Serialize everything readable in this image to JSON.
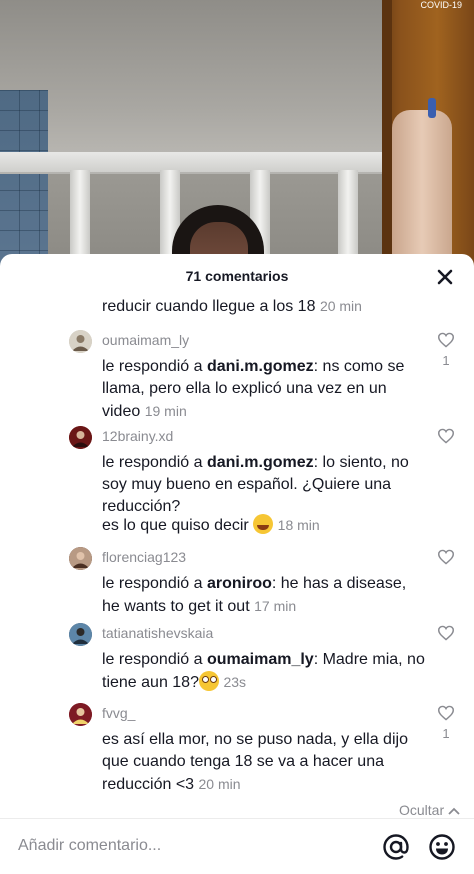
{
  "video": {
    "overlay_label": "COVID-19"
  },
  "sheet": {
    "title": "71 comentarios",
    "hide_label": "Ocultar"
  },
  "partial_comment": {
    "text": "reducir cuando llegue a los 18",
    "time": "20 min"
  },
  "comments": [
    {
      "username": "oumaimam_ly",
      "prefix": "le respondió a ",
      "mention": "dani.m.gomez",
      "text": ": ns como se llama, pero ella lo explicó una vez en un video",
      "time": "19 min",
      "likes": "1",
      "avatar_color": "#c9c4b8"
    },
    {
      "username": "12brainy.xd",
      "prefix": "le respondió a ",
      "mention": "dani.m.gomez",
      "text": ": lo siento, no soy muy bueno en español. ¿Quiere una reducción?",
      "text2": "es lo que quiso decir",
      "emoji": "face-with-tears-of-joy",
      "time": "18 min",
      "likes": "",
      "avatar_color": "#7a1a1a"
    },
    {
      "username": "florenciag123",
      "prefix": "le respondió a ",
      "mention": "aroniroo",
      "text": ": he has a disease, he wants to get it out",
      "time": "17 min",
      "likes": "",
      "avatar_color": "#6b4a3a"
    },
    {
      "username": "tatianatishevskaia",
      "prefix": "le respondió a ",
      "mention": "oumaimam_ly",
      "text": ": Madre mia, no tiene aun 18?",
      "emoji": "flushed-face",
      "time": "23s",
      "likes": "",
      "avatar_color": "#3b5a78"
    },
    {
      "username": "fvvg_",
      "text": "es así ella mor, no se puso nada, y ella dijo que cuando tenga 18 se va a hacer una reducción <3",
      "time": "20 min",
      "likes": "1",
      "avatar_color": "#8a1f2a"
    }
  ],
  "input": {
    "placeholder": "Añadir comentario..."
  },
  "colors": {
    "text": "#161823",
    "muted": "#8a8b91",
    "sheet_bg": "#ffffff"
  }
}
